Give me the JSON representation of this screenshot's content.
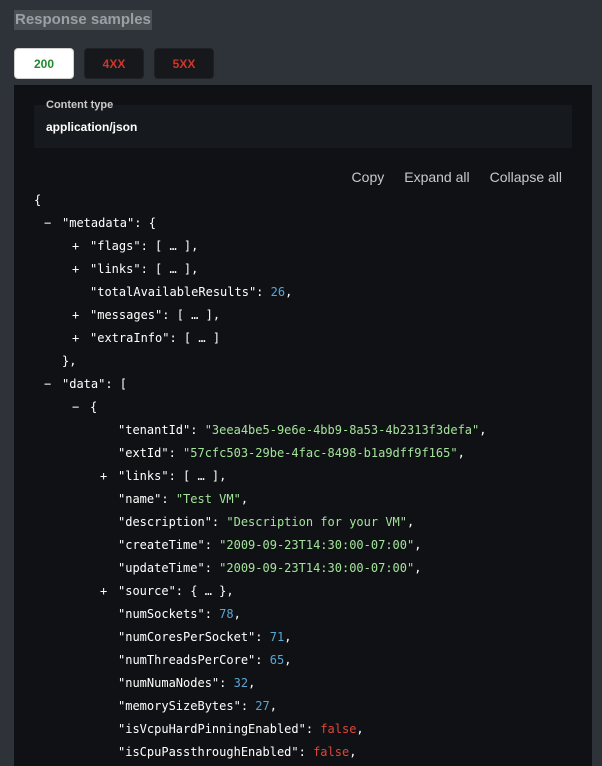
{
  "header": {
    "title": "Response samples"
  },
  "tabs": [
    {
      "label": "200"
    },
    {
      "label": "4XX"
    },
    {
      "label": "5XX"
    }
  ],
  "content_type": {
    "label": "Content type",
    "value": "application/json"
  },
  "actions": {
    "copy": "Copy",
    "expand": "Expand all",
    "collapse": "Collapse all"
  },
  "colors": {
    "string": "#a3e39a",
    "number": "#5aa6d6",
    "boolean": "#e0463b",
    "ok": "#1f8a2e",
    "error": "#d0362b"
  },
  "json": [
    {
      "indent": 0,
      "parts": [
        [
          "p",
          "{"
        ]
      ]
    },
    {
      "indent": 1,
      "toggle": "−",
      "parts": [
        [
          "k",
          "\"metadata\""
        ],
        [
          "p",
          ": {"
        ]
      ]
    },
    {
      "indent": 2,
      "toggle": "+",
      "parts": [
        [
          "k",
          "\"flags\""
        ],
        [
          "p",
          ": [ … ],"
        ]
      ]
    },
    {
      "indent": 2,
      "toggle": "+",
      "parts": [
        [
          "k",
          "\"links\""
        ],
        [
          "p",
          ": [ … ],"
        ]
      ]
    },
    {
      "indent": 2,
      "parts": [
        [
          "k",
          "\"totalAvailableResults\""
        ],
        [
          "p",
          ": "
        ],
        [
          "n",
          "26"
        ],
        [
          "p",
          ","
        ]
      ]
    },
    {
      "indent": 2,
      "toggle": "+",
      "parts": [
        [
          "k",
          "\"messages\""
        ],
        [
          "p",
          ": [ … ],"
        ]
      ]
    },
    {
      "indent": 2,
      "toggle": "+",
      "parts": [
        [
          "k",
          "\"extraInfo\""
        ],
        [
          "p",
          ": [ … ]"
        ]
      ]
    },
    {
      "indent": 1,
      "parts": [
        [
          "p",
          "},"
        ]
      ]
    },
    {
      "indent": 1,
      "toggle": "−",
      "parts": [
        [
          "k",
          "\"data\""
        ],
        [
          "p",
          ": ["
        ]
      ]
    },
    {
      "indent": 2,
      "toggle": "−",
      "parts": [
        [
          "p",
          "{"
        ]
      ]
    },
    {
      "indent": 3,
      "parts": [
        [
          "k",
          "\"tenantId\""
        ],
        [
          "p",
          ": "
        ],
        [
          "s",
          "\"3eea4be5-9e6e-4bb9-8a53-4b2313f3defa\""
        ],
        [
          "p",
          ","
        ]
      ]
    },
    {
      "indent": 3,
      "parts": [
        [
          "k",
          "\"extId\""
        ],
        [
          "p",
          ": "
        ],
        [
          "s",
          "\"57cfc503-29be-4fac-8498-b1a9dff9f165\""
        ],
        [
          "p",
          ","
        ]
      ]
    },
    {
      "indent": 3,
      "toggle": "+",
      "parts": [
        [
          "k",
          "\"links\""
        ],
        [
          "p",
          ": [ … ],"
        ]
      ]
    },
    {
      "indent": 3,
      "parts": [
        [
          "k",
          "\"name\""
        ],
        [
          "p",
          ": "
        ],
        [
          "s",
          "\"Test VM\""
        ],
        [
          "p",
          ","
        ]
      ]
    },
    {
      "indent": 3,
      "parts": [
        [
          "k",
          "\"description\""
        ],
        [
          "p",
          ": "
        ],
        [
          "s",
          "\"Description for your VM\""
        ],
        [
          "p",
          ","
        ]
      ]
    },
    {
      "indent": 3,
      "parts": [
        [
          "k",
          "\"createTime\""
        ],
        [
          "p",
          ": "
        ],
        [
          "s",
          "\"2009-09-23T14:30:00-07:00\""
        ],
        [
          "p",
          ","
        ]
      ]
    },
    {
      "indent": 3,
      "parts": [
        [
          "k",
          "\"updateTime\""
        ],
        [
          "p",
          ": "
        ],
        [
          "s",
          "\"2009-09-23T14:30:00-07:00\""
        ],
        [
          "p",
          ","
        ]
      ]
    },
    {
      "indent": 3,
      "toggle": "+",
      "parts": [
        [
          "k",
          "\"source\""
        ],
        [
          "p",
          ": { … },"
        ]
      ]
    },
    {
      "indent": 3,
      "parts": [
        [
          "k",
          "\"numSockets\""
        ],
        [
          "p",
          ": "
        ],
        [
          "n",
          "78"
        ],
        [
          "p",
          ","
        ]
      ]
    },
    {
      "indent": 3,
      "parts": [
        [
          "k",
          "\"numCoresPerSocket\""
        ],
        [
          "p",
          ": "
        ],
        [
          "n",
          "71"
        ],
        [
          "p",
          ","
        ]
      ]
    },
    {
      "indent": 3,
      "parts": [
        [
          "k",
          "\"numThreadsPerCore\""
        ],
        [
          "p",
          ": "
        ],
        [
          "n",
          "65"
        ],
        [
          "p",
          ","
        ]
      ]
    },
    {
      "indent": 3,
      "parts": [
        [
          "k",
          "\"numNumaNodes\""
        ],
        [
          "p",
          ": "
        ],
        [
          "n",
          "32"
        ],
        [
          "p",
          ","
        ]
      ]
    },
    {
      "indent": 3,
      "parts": [
        [
          "k",
          "\"memorySizeBytes\""
        ],
        [
          "p",
          ": "
        ],
        [
          "n",
          "27"
        ],
        [
          "p",
          ","
        ]
      ]
    },
    {
      "indent": 3,
      "parts": [
        [
          "k",
          "\"isVcpuHardPinningEnabled\""
        ],
        [
          "p",
          ": "
        ],
        [
          "b",
          "false"
        ],
        [
          "p",
          ","
        ]
      ]
    },
    {
      "indent": 3,
      "parts": [
        [
          "k",
          "\"isCpuPassthroughEnabled\""
        ],
        [
          "p",
          ": "
        ],
        [
          "b",
          "false"
        ],
        [
          "p",
          ","
        ]
      ]
    }
  ]
}
